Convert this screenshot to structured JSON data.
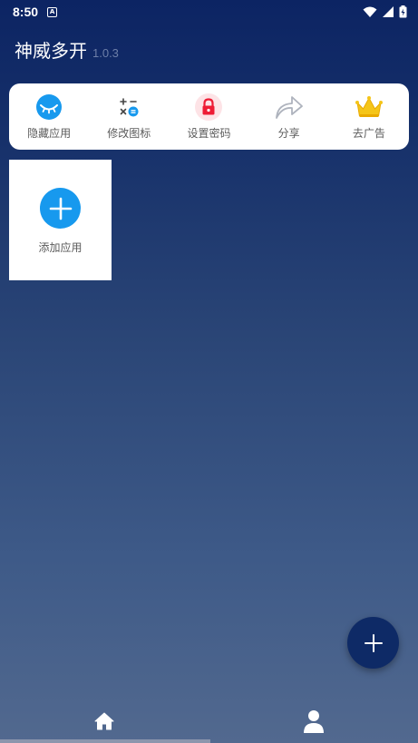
{
  "status_bar": {
    "time": "8:50",
    "notification_icon": "app-notification-icon",
    "icons": [
      "wifi-icon",
      "cell-signal-icon",
      "battery-charging-icon"
    ]
  },
  "header": {
    "title": "神威多开",
    "version": "1.0.3"
  },
  "toolbar": {
    "items": [
      {
        "label": "隐藏应用",
        "icon": "hide-eye-icon",
        "color": "#1799ee"
      },
      {
        "label": "修改图标",
        "icon": "calculator-icon",
        "color": "#1799ee"
      },
      {
        "label": "设置密码",
        "icon": "lock-icon",
        "color": "#ee1c35"
      },
      {
        "label": "分享",
        "icon": "share-arrow-icon",
        "color": "#aeb3bd"
      },
      {
        "label": "去广告",
        "icon": "crown-icon",
        "color": "#f5c518"
      }
    ]
  },
  "add_app": {
    "label": "添加应用",
    "icon": "plus-icon",
    "color": "#1799ee"
  },
  "fab": {
    "icon": "plus-icon",
    "color": "#0e2a66"
  },
  "bottom_nav": {
    "items": [
      {
        "icon": "home-icon",
        "selected": true
      },
      {
        "icon": "profile-icon",
        "selected": false
      }
    ]
  }
}
